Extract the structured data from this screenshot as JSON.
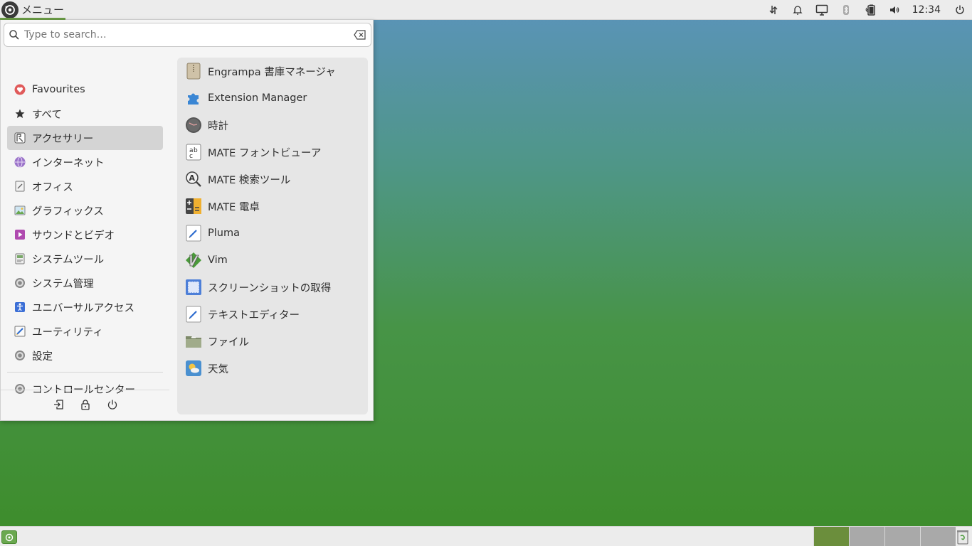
{
  "top_panel": {
    "menu_label": "メニュー",
    "clock": "12:34",
    "tray_icons": [
      "network-transfer-icon",
      "bell-icon",
      "display-icon",
      "bluetooth-icon",
      "battery-icon",
      "volume-icon",
      "power-icon"
    ]
  },
  "search": {
    "placeholder": "Type to search…",
    "value": ""
  },
  "categories": [
    {
      "label": "Favourites",
      "icon": "heart-icon"
    },
    {
      "label": "すべて",
      "icon": "star-icon"
    },
    {
      "label": "アクセサリー",
      "icon": "accessories-icon",
      "selected": true
    },
    {
      "label": "インターネット",
      "icon": "globe-icon"
    },
    {
      "label": "オフィス",
      "icon": "office-icon"
    },
    {
      "label": "グラフィックス",
      "icon": "graphics-icon"
    },
    {
      "label": "サウンドとビデオ",
      "icon": "multimedia-icon"
    },
    {
      "label": "システムツール",
      "icon": "system-tools-icon"
    },
    {
      "label": "システム管理",
      "icon": "admin-icon"
    },
    {
      "label": "ユニバーサルアクセス",
      "icon": "accessibility-icon"
    },
    {
      "label": "ユーティリティ",
      "icon": "utilities-icon"
    },
    {
      "label": "設定",
      "icon": "settings-icon"
    }
  ],
  "control_center": {
    "label": "コントロールセンター",
    "icon": "control-center-icon"
  },
  "session": [
    "logout-icon",
    "lock-icon",
    "shutdown-icon"
  ],
  "apps": [
    {
      "label": "Engrampa 書庫マネージャ",
      "icon": "archive-manager-icon"
    },
    {
      "label": "Extension Manager",
      "icon": "extension-icon"
    },
    {
      "label": "時計",
      "icon": "clock-icon"
    },
    {
      "label": "MATE フォントビューア",
      "icon": "font-viewer-icon"
    },
    {
      "label": "MATE 検索ツール",
      "icon": "search-tool-icon"
    },
    {
      "label": "MATE 電卓",
      "icon": "calculator-icon"
    },
    {
      "label": "Pluma",
      "icon": "text-editor-icon"
    },
    {
      "label": "Vim",
      "icon": "vim-icon"
    },
    {
      "label": "スクリーンショットの取得",
      "icon": "screenshot-icon"
    },
    {
      "label": "テキストエディター",
      "icon": "text-editor-icon"
    },
    {
      "label": "ファイル",
      "icon": "folder-icon"
    },
    {
      "label": "天気",
      "icon": "weather-icon"
    }
  ],
  "colors": {
    "panel_bg": "#ececec",
    "menu_bg": "#f5f5f5",
    "selected_bg": "#d4d4d4",
    "accent": "#6a9c47",
    "workspace_active": "#6b8e3c"
  }
}
